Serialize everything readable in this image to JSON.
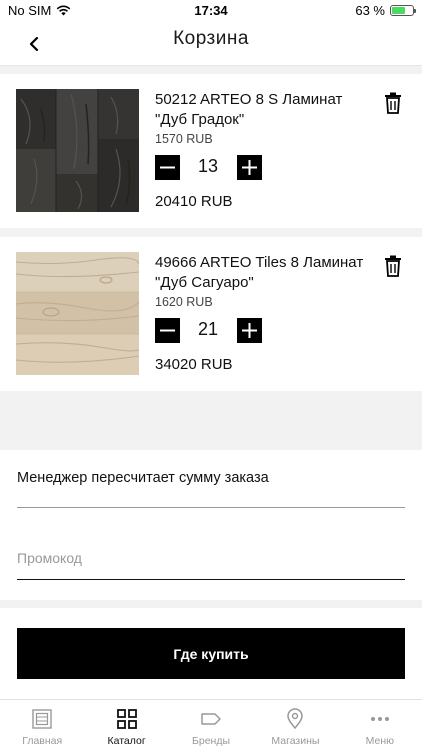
{
  "status_bar": {
    "carrier": "No SIM",
    "time": "17:34",
    "battery": "63 %",
    "battery_level": 0.63
  },
  "header": {
    "title": "Корзина"
  },
  "cart": {
    "items": [
      {
        "name": "50212 ARTEO 8 S  Ламинат \"Дуб Градок\"",
        "unit_price": "1570 RUB",
        "quantity": "13",
        "total": "20410 RUB",
        "image": "dark-oak-laminate"
      },
      {
        "name": "49666 ARTEO Tiles 8 Ламинат \"Дуб Сагуаро\"",
        "unit_price": "1620 RUB",
        "quantity": "21",
        "total": "34020 RUB",
        "image": "light-oak-laminate"
      }
    ]
  },
  "form": {
    "manager_note": "Менеджер пересчитает сумму заказа",
    "promo_placeholder": "Промокод",
    "promo_value": ""
  },
  "buy_button": {
    "label": "Где купить"
  },
  "tab_bar": {
    "tabs": [
      {
        "label": "Главная",
        "icon": "home-pattern-icon",
        "active": false
      },
      {
        "label": "Каталог",
        "icon": "grid-icon",
        "active": true
      },
      {
        "label": "Бренды",
        "icon": "tag-icon",
        "active": false
      },
      {
        "label": "Магазины",
        "icon": "map-pin-icon",
        "active": false
      },
      {
        "label": "Меню",
        "icon": "more-dots-icon",
        "active": false
      }
    ]
  },
  "colors": {
    "accent": "#000000",
    "background": "#f2f2f2",
    "battery": "#4cd964"
  }
}
